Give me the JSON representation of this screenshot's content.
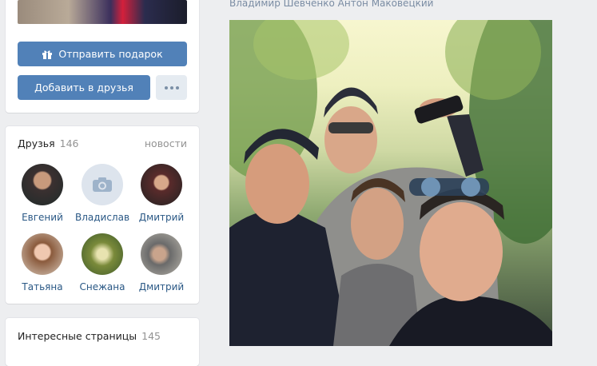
{
  "actions": {
    "gift_label": "Отправить подарок",
    "add_friend_label": "Добавить в друзья"
  },
  "friends": {
    "title": "Друзья",
    "count": "146",
    "news_link": "новости",
    "items": [
      {
        "name": "Евгений"
      },
      {
        "name": "Владислав"
      },
      {
        "name": "Дмитрий"
      },
      {
        "name": "Татьяна"
      },
      {
        "name": "Снежана"
      },
      {
        "name": "Дмитрий"
      }
    ]
  },
  "pages": {
    "title": "Интересные страницы",
    "count": "145"
  },
  "post": {
    "tagged_people": "Владимир Шевченко Антон Маковецкий"
  },
  "colors": {
    "accent": "#5181b8",
    "link": "#2a5885",
    "background": "#edeef0"
  }
}
